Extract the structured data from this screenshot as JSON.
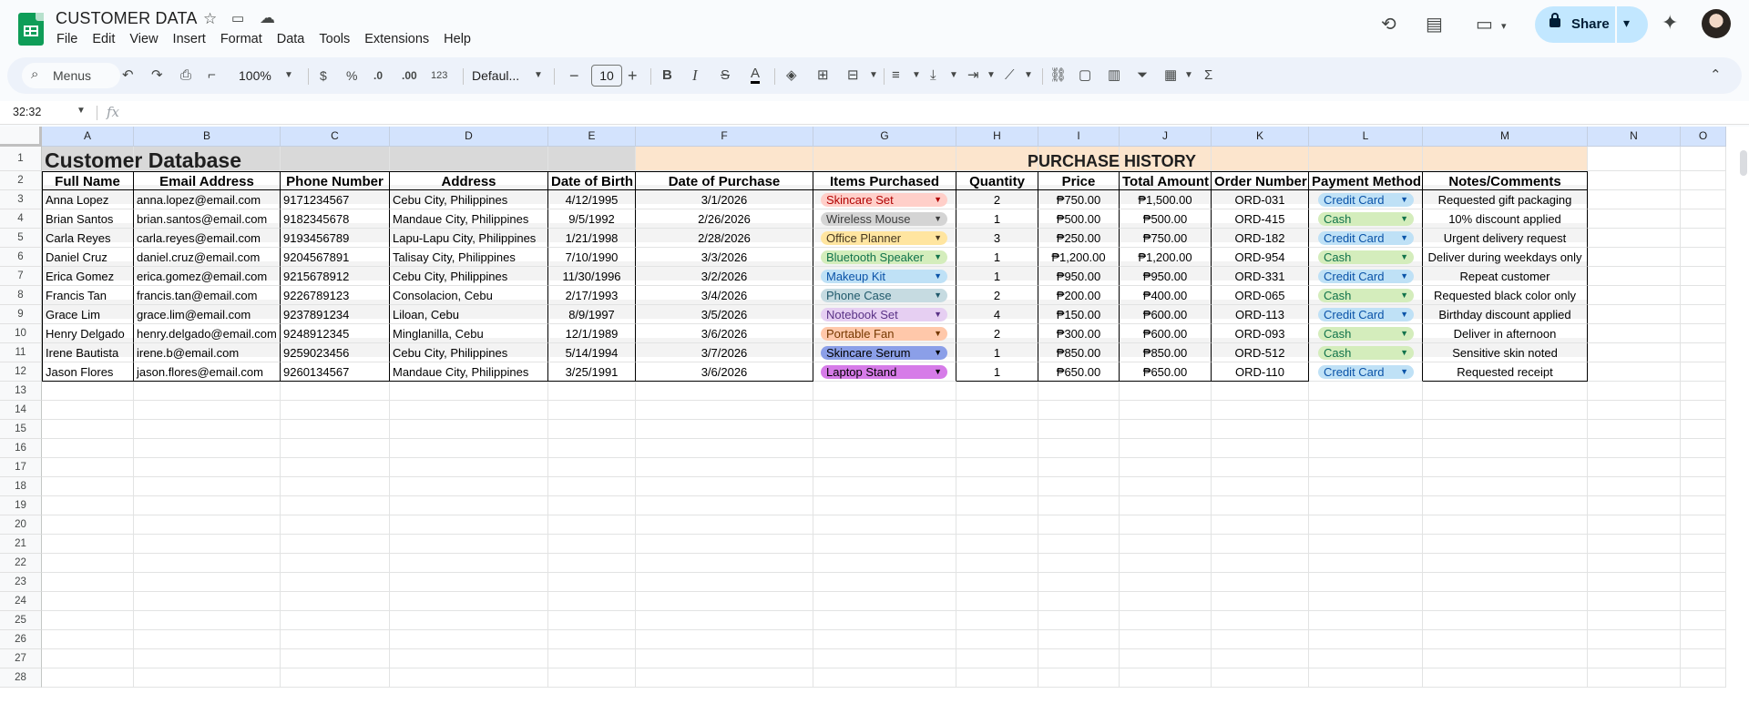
{
  "app": {
    "doc_title": "CUSTOMER DATA",
    "menu": [
      "File",
      "Edit",
      "View",
      "Insert",
      "Format",
      "Data",
      "Tools",
      "Extensions",
      "Help"
    ],
    "share_label": "Share"
  },
  "toolbar": {
    "search_placeholder": "Menus",
    "zoom": "100%",
    "currency": "$",
    "percent": "%",
    "dec_decrease": ".0",
    "dec_increase": ".00",
    "number_format": "123",
    "font": "Defaul...",
    "font_size": "10",
    "bold": "B",
    "italic": "I",
    "strike": "S",
    "text_color": "A"
  },
  "formula_bar": {
    "name_box": "32:32",
    "fx": "fx",
    "value": ""
  },
  "sheet": {
    "columns": [
      "A",
      "B",
      "C",
      "D",
      "E",
      "F",
      "G",
      "H",
      "I",
      "J",
      "K",
      "L",
      "M",
      "N",
      "O"
    ],
    "row_numbers": [
      "1",
      "2",
      "3",
      "4",
      "5",
      "6",
      "7",
      "8",
      "9",
      "10",
      "11",
      "12",
      "13",
      "14",
      "15",
      "16",
      "17",
      "18",
      "19",
      "20",
      "21",
      "22",
      "23",
      "24",
      "25",
      "26",
      "27",
      "28"
    ],
    "customer_title": "Customer Database",
    "purchase_title": "PURCHASE HISTORY",
    "headers": [
      "Full Name",
      "Email Address",
      "Phone Number",
      "Address",
      "Date of Birth",
      "Date of Purchase",
      "Items Purchased",
      "Quantity",
      "Price",
      "Total Amount",
      "Order Number",
      "Payment Method",
      "Notes/Comments"
    ],
    "rows": [
      [
        "Anna Lopez",
        "anna.lopez@email.com",
        "9171234567",
        "Cebu City, Philippines",
        "4/12/1995",
        "3/1/2026",
        "Skincare Set",
        "2",
        "₱750.00",
        "₱1,500.00",
        "ORD-031",
        "Credit Card",
        "Requested gift packaging"
      ],
      [
        "Brian Santos",
        "brian.santos@email.com",
        "9182345678",
        "Mandaue City, Philippines",
        "9/5/1992",
        "2/26/2026",
        "Wireless Mouse",
        "1",
        "₱500.00",
        "₱500.00",
        "ORD-415",
        "Cash",
        "10% discount applied"
      ],
      [
        "Carla Reyes",
        "carla.reyes@email.com",
        "9193456789",
        "Lapu-Lapu City, Philippines",
        "1/21/1998",
        "2/28/2026",
        "Office Planner",
        "3",
        "₱250.00",
        "₱750.00",
        "ORD-182",
        "Credit Card",
        "Urgent delivery request"
      ],
      [
        "Daniel Cruz",
        "daniel.cruz@email.com",
        "9204567891",
        "Talisay City, Philippines",
        "7/10/1990",
        "3/3/2026",
        "Bluetooth Speaker",
        "1",
        "₱1,200.00",
        "₱1,200.00",
        "ORD-954",
        "Cash",
        "Deliver during weekdays only"
      ],
      [
        "Erica Gomez",
        "erica.gomez@email.com",
        "9215678912",
        "Cebu City, Philippines",
        "11/30/1996",
        "3/2/2026",
        "Makeup Kit",
        "1",
        "₱950.00",
        "₱950.00",
        "ORD-331",
        "Credit Card",
        "Repeat customer"
      ],
      [
        "Francis Tan",
        "francis.tan@email.com",
        "9226789123",
        "Consolacion, Cebu",
        "2/17/1993",
        "3/4/2026",
        "Phone Case",
        "2",
        "₱200.00",
        "₱400.00",
        "ORD-065",
        "Cash",
        "Requested black color only"
      ],
      [
        "Grace Lim",
        "grace.lim@email.com",
        "9237891234",
        "Liloan, Cebu",
        "8/9/1997",
        "3/5/2026",
        "Notebook Set",
        "4",
        "₱150.00",
        "₱600.00",
        "ORD-113",
        "Credit Card",
        "Birthday discount applied"
      ],
      [
        "Henry Delgado",
        "henry.delgado@email.com",
        "9248912345",
        "Minglanilla, Cebu",
        "12/1/1989",
        "3/6/2026",
        "Portable Fan",
        "2",
        "₱300.00",
        "₱600.00",
        "ORD-093",
        "Cash",
        "Deliver in afternoon"
      ],
      [
        "Irene Bautista",
        "irene.b@email.com",
        "9259023456",
        "Cebu City, Philippines",
        "5/14/1994",
        "3/7/2026",
        "Skincare Serum",
        "1",
        "₱850.00",
        "₱850.00",
        "ORD-512",
        "Cash",
        "Sensitive skin noted"
      ],
      [
        "Jason Flores",
        "jason.flores@email.com",
        "9260134567",
        "Mandaue City, Philippines",
        "3/25/1991",
        "3/6/2026",
        "Laptop Stand",
        "1",
        "₱650.00",
        "₱650.00",
        "ORD-110",
        "Credit Card",
        "Requested receipt"
      ]
    ],
    "item_chip_colors": [
      "#ffcfc9",
      "#d4d4d4",
      "#ffe5a0",
      "#d4edbc",
      "#bfe1f6",
      "#c6dbe1",
      "#e6cff2",
      "#ffc8aa",
      "#8b9fe8",
      "#d67be8"
    ],
    "item_chip_text_colors": [
      "#b10202",
      "#3d3d3d",
      "#473821",
      "#11734b",
      "#0a53a8",
      "#215a6c",
      "#5a3286",
      "#753800",
      "#000000",
      "#000000"
    ],
    "payment_colors": {
      "Credit Card": "#bfe1f6",
      "Cash": "#d4edbc"
    },
    "payment_text_colors": {
      "Credit Card": "#0a53a8",
      "Cash": "#11734b"
    },
    "purchase_header_bg": "#fce5cd",
    "customer_header_bg": "#d9d9d9"
  }
}
